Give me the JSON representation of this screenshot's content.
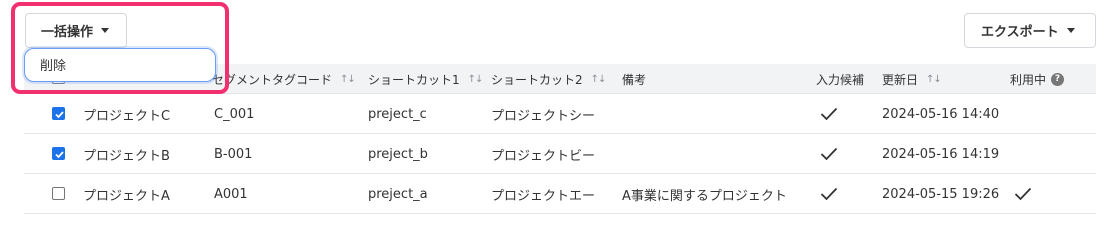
{
  "toolbar": {
    "bulk_action_label": "一括操作",
    "export_label": "エクスポート"
  },
  "bulk_menu": {
    "items": [
      {
        "label": "削除"
      }
    ]
  },
  "table": {
    "columns": [
      {
        "key": "name",
        "label": ""
      },
      {
        "key": "segment_tag_code",
        "label": "セグメントタグコード",
        "sortable": true
      },
      {
        "key": "shortcut1",
        "label": "ショートカット1",
        "sortable": true
      },
      {
        "key": "shortcut2",
        "label": "ショートカット2",
        "sortable": true
      },
      {
        "key": "note",
        "label": "備考"
      },
      {
        "key": "input_candidate",
        "label": "入力候補"
      },
      {
        "key": "updated_at",
        "label": "更新日",
        "sortable": true
      },
      {
        "key": "in_use",
        "label": "利用中",
        "help": "?"
      }
    ],
    "rows": [
      {
        "checked": true,
        "name": "プロジェクトC",
        "code": "C_001",
        "shortcut1": "preject_c",
        "shortcut2": "プロジェクトシー",
        "note": "",
        "input_candidate": true,
        "updated": "2024-05-16 14:40",
        "in_use": false
      },
      {
        "checked": true,
        "name": "プロジェクトB",
        "code": "B-001",
        "shortcut1": "preject_b",
        "shortcut2": "プロジェクトビー",
        "note": "",
        "input_candidate": true,
        "updated": "2024-05-16 14:19",
        "in_use": false
      },
      {
        "checked": false,
        "name": "プロジェクトA",
        "code": "A001",
        "shortcut1": "preject_a",
        "shortcut2": "プロジェクトエー",
        "note": "A事業に関するプロジェクト",
        "input_candidate": true,
        "updated": "2024-05-15 19:26",
        "in_use": true
      }
    ]
  },
  "colors": {
    "accent": "#1a73e8",
    "highlight": "#f0306f",
    "header_bg": "#f2f3f5",
    "focus_border": "#6d9cf2"
  },
  "icons": {
    "check": "check-icon",
    "sort": "sort-icon",
    "caret": "caret-down-icon",
    "help": "help-icon"
  }
}
